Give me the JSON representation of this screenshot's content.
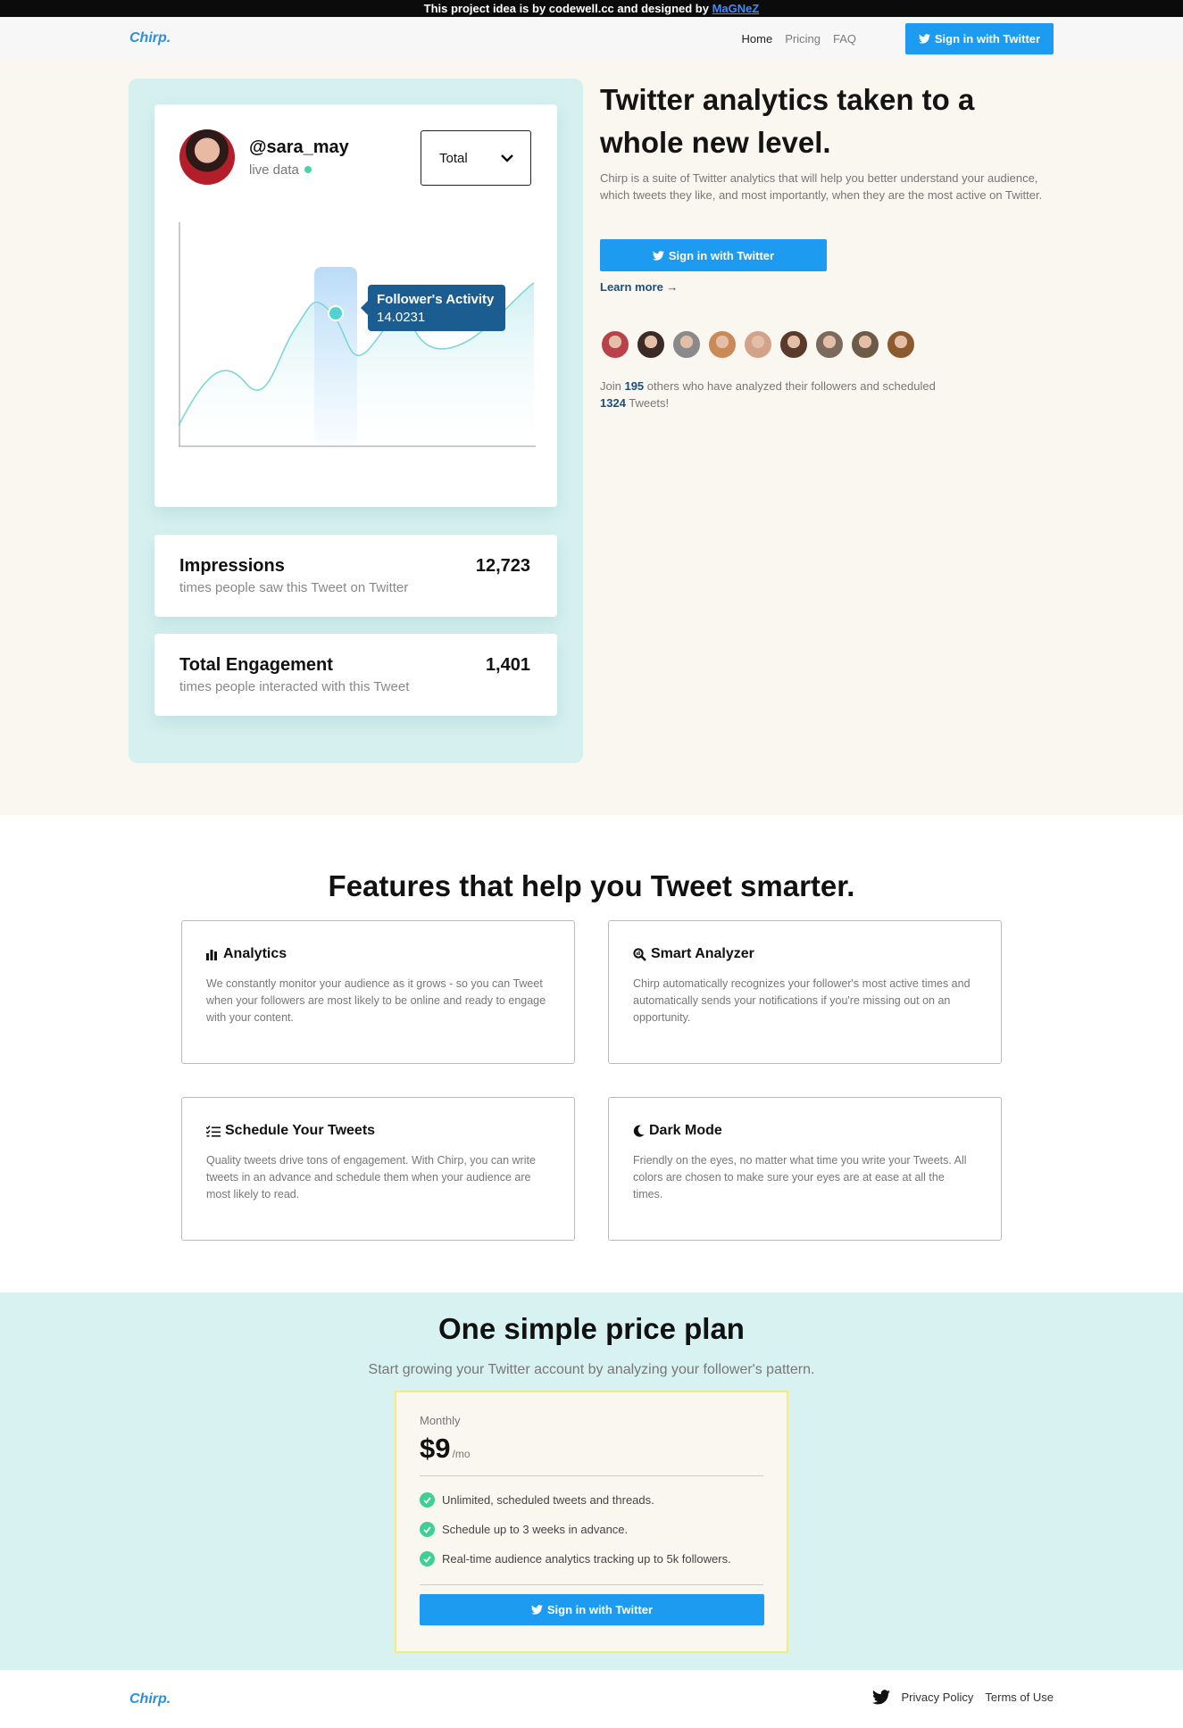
{
  "banner": {
    "text": "This project idea is by codewell.cc and designed by ",
    "link": "MaGNeZ"
  },
  "nav": {
    "logo": "Chirp.",
    "links": [
      "Home",
      "Pricing",
      "FAQ"
    ],
    "cta": "Sign in with Twitter"
  },
  "profile": {
    "handle": "@sara_may",
    "status": "live data",
    "select_value": "Total",
    "tooltip_title": "Follower's Activity",
    "tooltip_value": "14.0231"
  },
  "stats": [
    {
      "title": "Impressions",
      "subtitle": "times people saw this Tweet on Twitter",
      "value": "12,723"
    },
    {
      "title": "Total Engagement",
      "subtitle": "times people interacted with this Tweet",
      "value": "1,401"
    }
  ],
  "hero": {
    "title": "Twitter analytics taken to a whole new level.",
    "description": "Chirp is a suite of Twitter analytics that will help you better understand your audience, which tweets they like, and most importantly, when they are the most active on Twitter.",
    "cta": "Sign in with Twitter",
    "learn_more": "Learn more →",
    "join_prefix": "Join ",
    "join_count": "195",
    "join_mid": " others who have analyzed their followers and scheduled ",
    "join_tweets": "1324",
    "join_suffix": " Tweets!"
  },
  "avatar_colors": [
    "#b9424a",
    "#3b2a26",
    "#8a8a8a",
    "#c98a57",
    "#d2a38a",
    "#5a3a2a",
    "#7b6a5d",
    "#6c5b49",
    "#8c5a2e"
  ],
  "features": {
    "title": "Features that help you Tweet smarter.",
    "items": [
      {
        "icon": "bar-chart-icon",
        "title": "Analytics",
        "desc": "We constantly monitor your audience as it grows - so you can Tweet when your followers are most likely to be online and ready to engage with your content."
      },
      {
        "icon": "search-chart-icon",
        "title": "Smart Analyzer",
        "desc": "Chirp automatically recognizes your follower's most active times and automatically sends your notifications if you're missing out on an opportunity."
      },
      {
        "icon": "list-check-icon",
        "title": "Schedule Your Tweets",
        "desc": "Quality tweets drive tons of engagement. With Chirp, you can write tweets in an advance and schedule them when your audience are most likely to read."
      },
      {
        "icon": "moon-icon",
        "title": "Dark Mode",
        "desc": "Friendly on the eyes, no matter what time you write your Tweets. All colors are chosen to make sure your eyes are at ease at all the times."
      }
    ]
  },
  "pricing": {
    "title": "One simple price plan",
    "subtitle": "Start growing your Twitter account by analyzing your follower's pattern.",
    "plan_label": "Monthly",
    "price": "$9",
    "period": "/mo",
    "items": [
      "Unlimited, scheduled tweets and threads.",
      "Schedule up to 3 weeks in advance.",
      "Real-time audience analytics tracking up to 5k followers."
    ],
    "cta": "Sign in with Twitter"
  },
  "footer": {
    "logo": "Chirp.",
    "links": [
      "Privacy Policy",
      "Terms of Use"
    ]
  },
  "colors": {
    "twitter_blue": "#1d9bf0",
    "accent_navy": "#1c4f7a",
    "mint": "#d6f0ef",
    "cream": "#faf6f0"
  }
}
